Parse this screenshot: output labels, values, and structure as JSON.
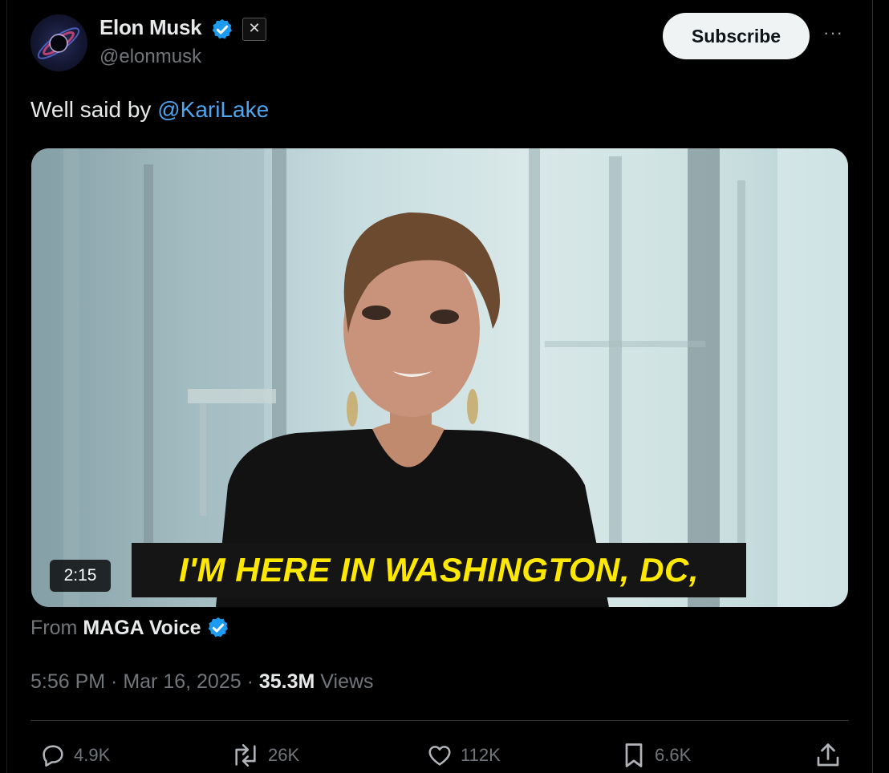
{
  "author": {
    "name": "Elon Musk",
    "handle": "@elonmusk",
    "verified_color": "#1d9bf0",
    "affiliate_badge_icon": "x-logo-icon"
  },
  "header": {
    "subscribe_label": "Subscribe",
    "more_label": "···"
  },
  "tweet": {
    "text_prefix": "Well said by ",
    "mention": "@KariLake"
  },
  "media": {
    "duration": "2:15",
    "caption": "I'M HERE IN WASHINGTON, DC,",
    "caption_color": "#ffe800"
  },
  "source": {
    "from_label": "From",
    "name": "MAGA Voice"
  },
  "meta": {
    "time_date": "5:56 PM · Mar 16, 2025 · ",
    "views_count": "35.3M",
    "views_label": " Views"
  },
  "actions": {
    "reply": {
      "icon": "reply-icon",
      "count": "4.9K"
    },
    "repost": {
      "icon": "repost-icon",
      "count": "26K"
    },
    "like": {
      "icon": "heart-icon",
      "count": "112K"
    },
    "bookmark": {
      "icon": "bookmark-icon",
      "count": "6.6K"
    },
    "share": {
      "icon": "share-icon"
    }
  },
  "colors": {
    "background": "#000000",
    "text": "#e7e9ea",
    "muted": "#71767b",
    "link": "#4ea5f0"
  }
}
